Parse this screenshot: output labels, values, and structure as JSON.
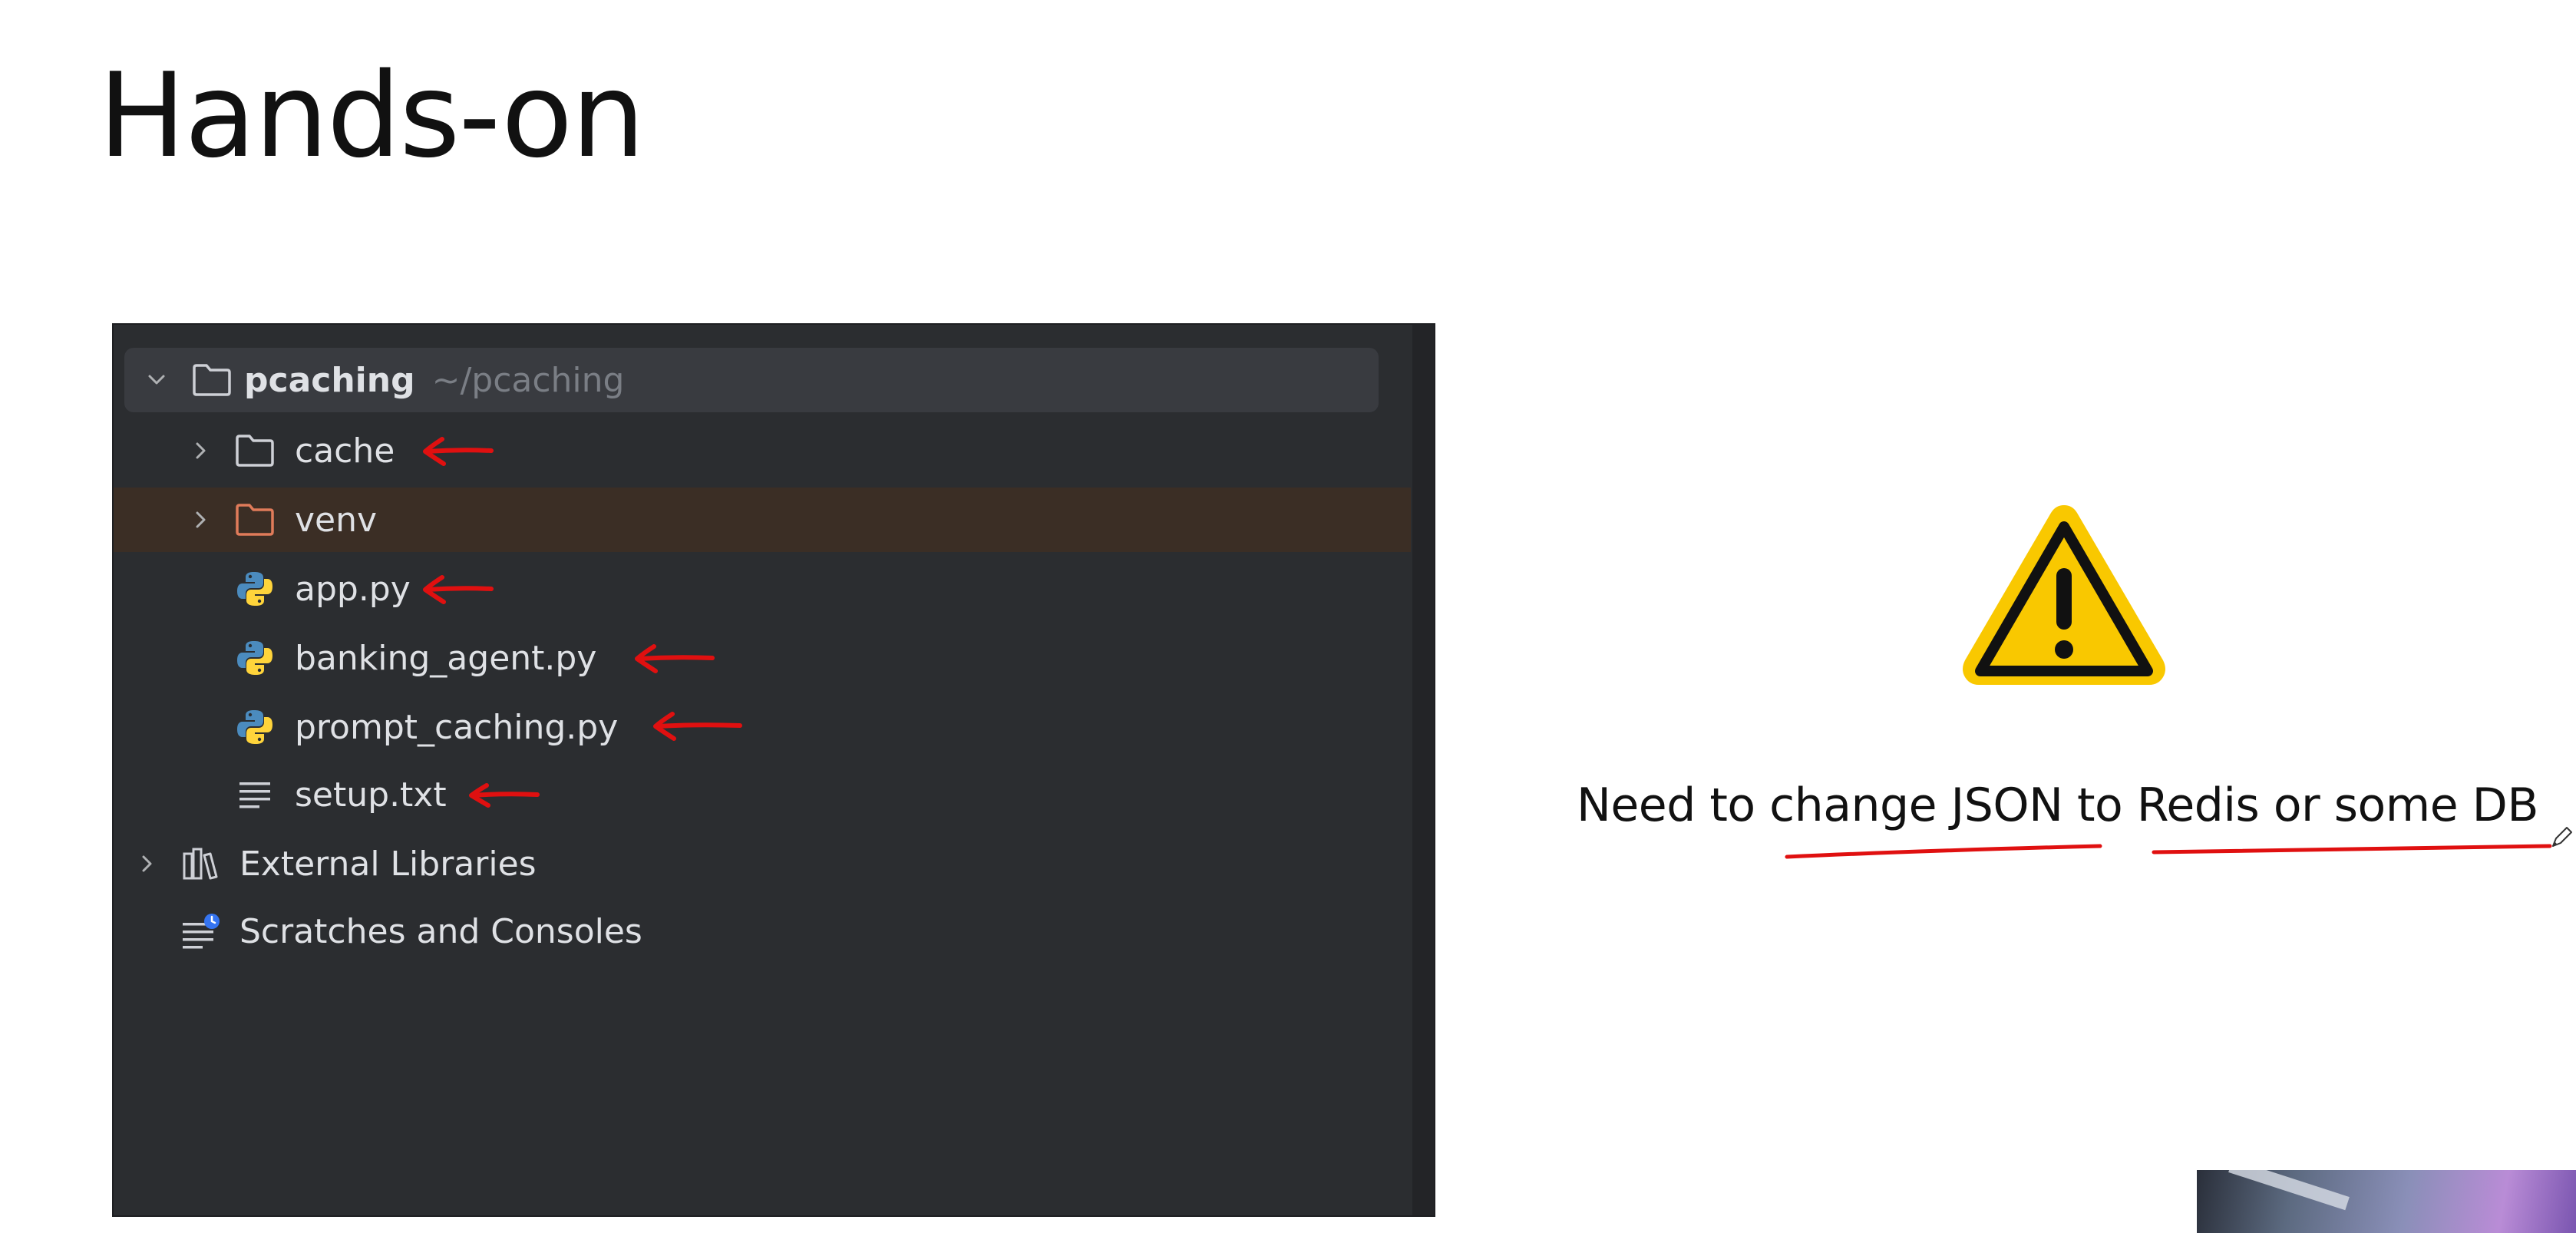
{
  "slide": {
    "title": "Hands-on"
  },
  "project_tree": {
    "root": {
      "name": "pcaching",
      "path": "~/pcaching"
    },
    "items": [
      {
        "label": "cache",
        "type": "folder",
        "icon": "folder-icon"
      },
      {
        "label": "venv",
        "type": "folder",
        "icon": "folder-icon",
        "excluded": true
      },
      {
        "label": "app.py",
        "type": "file",
        "icon": "python-file-icon"
      },
      {
        "label": "banking_agent.py",
        "type": "file",
        "icon": "python-file-icon"
      },
      {
        "label": "prompt_caching.py",
        "type": "file",
        "icon": "python-file-icon"
      },
      {
        "label": "setup.txt",
        "type": "file",
        "icon": "text-file-icon"
      }
    ],
    "external_libraries": "External Libraries",
    "scratches": "Scratches and Consoles"
  },
  "note": {
    "text": "Need to change JSON to Redis or some DB",
    "icon": "warning-icon"
  },
  "colors": {
    "annotation_red": "#e01010",
    "ide_background": "#2b2d30",
    "root_row_highlight": "#393b40",
    "excluded_row": "#3b2e25",
    "warning_yellow": "#f9c800"
  }
}
